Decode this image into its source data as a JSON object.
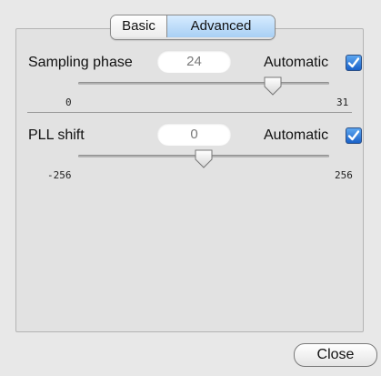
{
  "tabs": [
    {
      "label": "Basic",
      "selected": false
    },
    {
      "label": "Advanced",
      "selected": true
    }
  ],
  "sampling_phase": {
    "label": "Sampling phase",
    "value": "24",
    "automatic_label": "Automatic",
    "automatic_checked": true,
    "min_label": "0",
    "max_label": "31",
    "min": 0,
    "max": 31,
    "current": 24
  },
  "pll_shift": {
    "label": "PLL shift",
    "value": "0",
    "automatic_label": "Automatic",
    "automatic_checked": true,
    "min_label": "-256",
    "max_label": "256",
    "min": -256,
    "max": 256,
    "current": 0
  },
  "close_label": "Close",
  "accent_color": "#1a61c8"
}
